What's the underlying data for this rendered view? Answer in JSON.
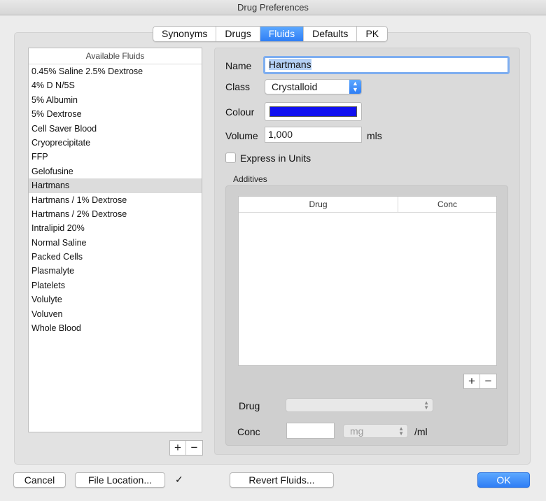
{
  "window": {
    "title": "Drug Preferences"
  },
  "tabs": [
    {
      "label": "Synonyms",
      "active": false
    },
    {
      "label": "Drugs",
      "active": false
    },
    {
      "label": "Fluids",
      "active": true
    },
    {
      "label": "Defaults",
      "active": false
    },
    {
      "label": "PK",
      "active": false
    }
  ],
  "fluids_list": {
    "header": "Available Fluids",
    "selected_index": 8,
    "items": [
      "0.45% Saline 2.5% Dextrose",
      "4% D N/5S",
      "5% Albumin",
      "5% Dextrose",
      "Cell Saver Blood",
      "Cryoprecipitate",
      "FFP",
      "Gelofusine",
      "Hartmans",
      "Hartmans / 1% Dextrose",
      "Hartmans / 2% Dextrose",
      "Intralipid 20%",
      "Normal Saline",
      "Packed Cells",
      "Plasmalyte",
      "Platelets",
      "Volulyte",
      "Voluven",
      "Whole Blood"
    ],
    "add_label": "+",
    "remove_label": "−"
  },
  "detail": {
    "name_label": "Name",
    "name_value": "Hartmans",
    "class_label": "Class",
    "class_value": "Crystalloid",
    "colour_label": "Colour",
    "colour_value": "#1010f0",
    "volume_label": "Volume",
    "volume_value": "1,000",
    "volume_unit": "mls",
    "express_units_label": "Express in Units",
    "express_units_checked": false
  },
  "additives": {
    "title": "Additives",
    "columns": [
      "Drug",
      "Conc"
    ],
    "rows": [],
    "add_label": "+",
    "remove_label": "−",
    "drug_label": "Drug",
    "drug_value": "",
    "conc_label": "Conc",
    "conc_value": "",
    "conc_unit_value": "mg",
    "per_unit": "/ml"
  },
  "footer": {
    "cancel_label": "Cancel",
    "file_location_label": "File Location...",
    "checkmark": "✓",
    "revert_label": "Revert Fluids...",
    "ok_label": "OK"
  },
  "colors": {
    "accent": "#2f7ef5",
    "selection": "#b4d0f5"
  }
}
